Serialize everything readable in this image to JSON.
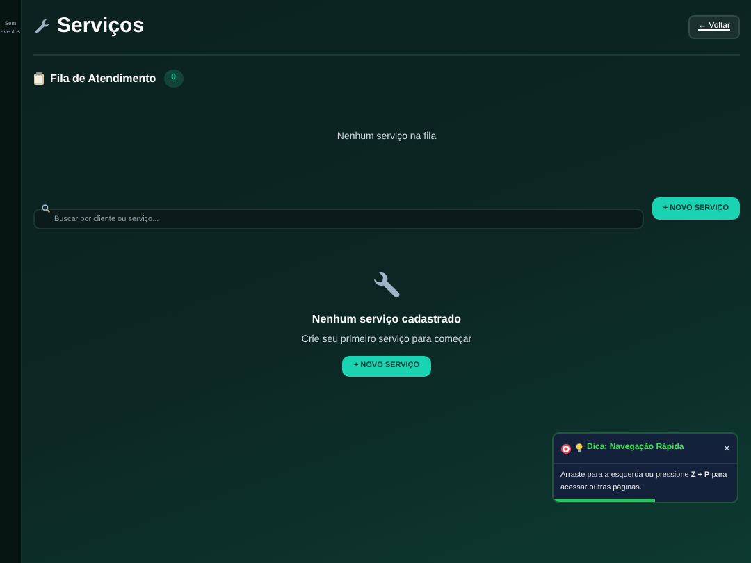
{
  "sidebar": {
    "text": "Sem eventos"
  },
  "header": {
    "title": "Serviços",
    "back_button": "← Voltar"
  },
  "queue": {
    "title": "Fila de Atendimento",
    "count": "0",
    "empty_text": "Nenhum serviço na fila"
  },
  "search": {
    "placeholder": "Buscar por cliente ou serviço...",
    "new_button": "+ NOVO SERVIÇO"
  },
  "empty_state": {
    "title": "Nenhum serviço cadastrado",
    "subtitle": "Crie seu primeiro serviço para começar",
    "button": "+ NOVO SERVIÇO"
  },
  "toast": {
    "title": "Dica: Navegação Rápida",
    "close": "×",
    "message": "Arraste para a esquerda ou pressione **Z + P** para acessar outras páginas.",
    "level": 0.55
  }
}
